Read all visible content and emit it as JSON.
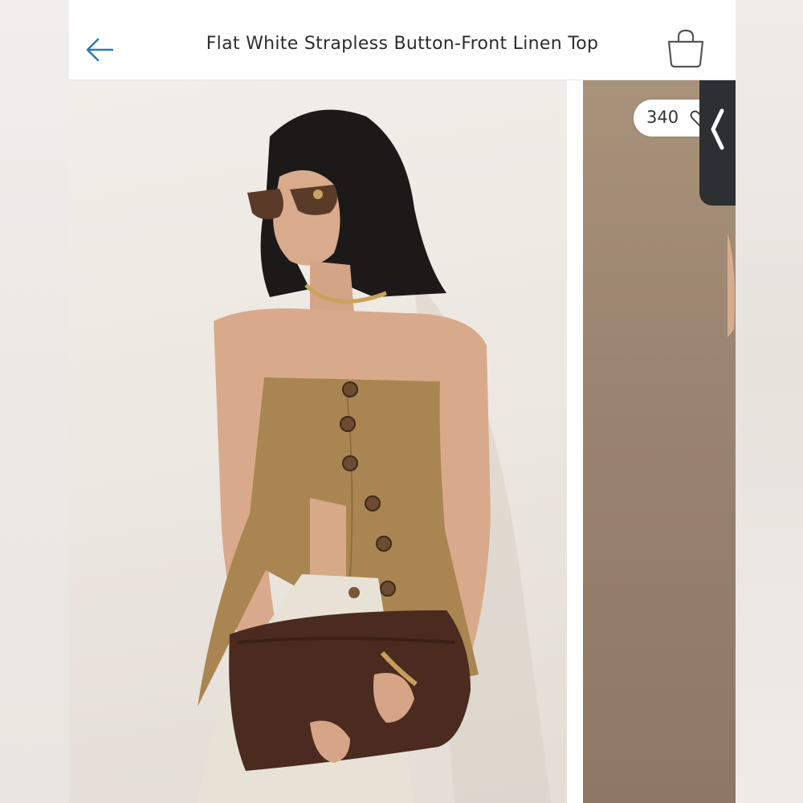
{
  "header": {
    "title": "Flat White Strapless Button-Front Linen Top",
    "back_icon": "arrow-left-icon",
    "cart_icon": "shopping-bag-icon"
  },
  "gallery": {
    "like_count": "340",
    "like_icon": "heart-icon",
    "drawer_icon": "chevron-left-icon"
  },
  "colors": {
    "accent": "#2a7ab8",
    "tab_bg": "#2e2f31"
  }
}
